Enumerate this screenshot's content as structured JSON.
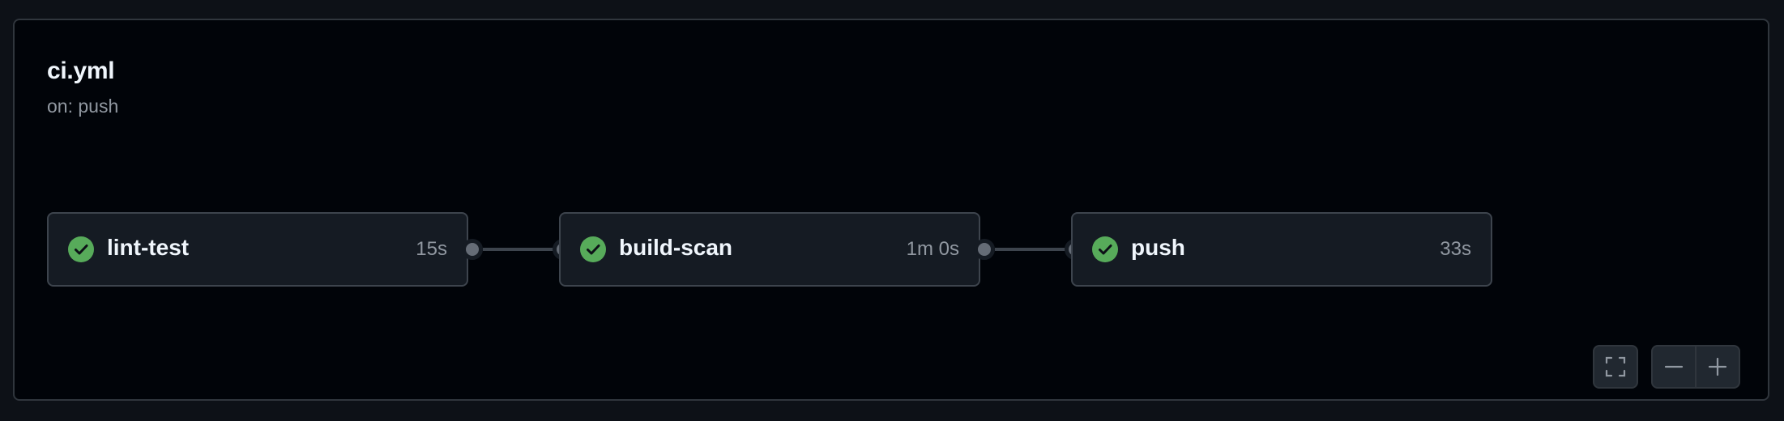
{
  "workflow": {
    "title": "ci.yml",
    "trigger": "on: push"
  },
  "jobs": [
    {
      "name": "lint-test",
      "duration": "15s",
      "status": "success",
      "status_icon": "check-circle-icon"
    },
    {
      "name": "build-scan",
      "duration": "1m 0s",
      "status": "success",
      "status_icon": "check-circle-icon"
    },
    {
      "name": "push",
      "duration": "33s",
      "status": "success",
      "status_icon": "check-circle-icon"
    }
  ],
  "controls": {
    "fullscreen_icon": "fullscreen-icon",
    "zoom_out_icon": "minus-icon",
    "zoom_in_icon": "plus-icon"
  },
  "colors": {
    "success": "#57ab5a",
    "panel_bg": "#010409",
    "page_bg": "#0d1117",
    "job_bg": "#151b23"
  }
}
